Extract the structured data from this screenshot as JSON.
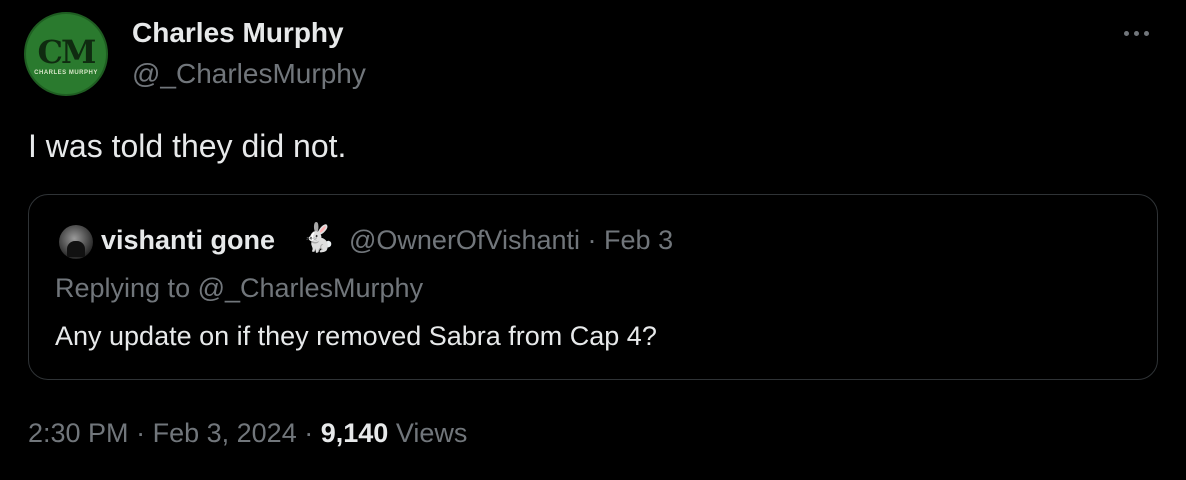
{
  "author": {
    "avatar_monogram": "CM",
    "avatar_subtitle": "CHARLES MURPHY",
    "name": "Charles Murphy",
    "handle": "@_CharlesMurphy"
  },
  "more_icon": "more-horizontal-icon",
  "tweet": {
    "text": "I was told they did not."
  },
  "quoted": {
    "name": "vishanti gone",
    "emoji": "🐇",
    "handle": "@OwnerOfVishanti",
    "separator": "·",
    "date": "Feb 3",
    "replying_to": "Replying to @_CharlesMurphy",
    "text": "Any update on if they removed Sabra from Cap 4?"
  },
  "footer": {
    "time": "2:30 PM",
    "sep1": "·",
    "date": "Feb 3, 2024",
    "sep2": "·",
    "views_count": "9,140",
    "views_label": "Views"
  },
  "colors": {
    "background": "#000000",
    "primary_text": "#e7e9ea",
    "secondary_text": "#71767b",
    "border": "#2f3336",
    "avatar_green": "#2a7a2e"
  }
}
